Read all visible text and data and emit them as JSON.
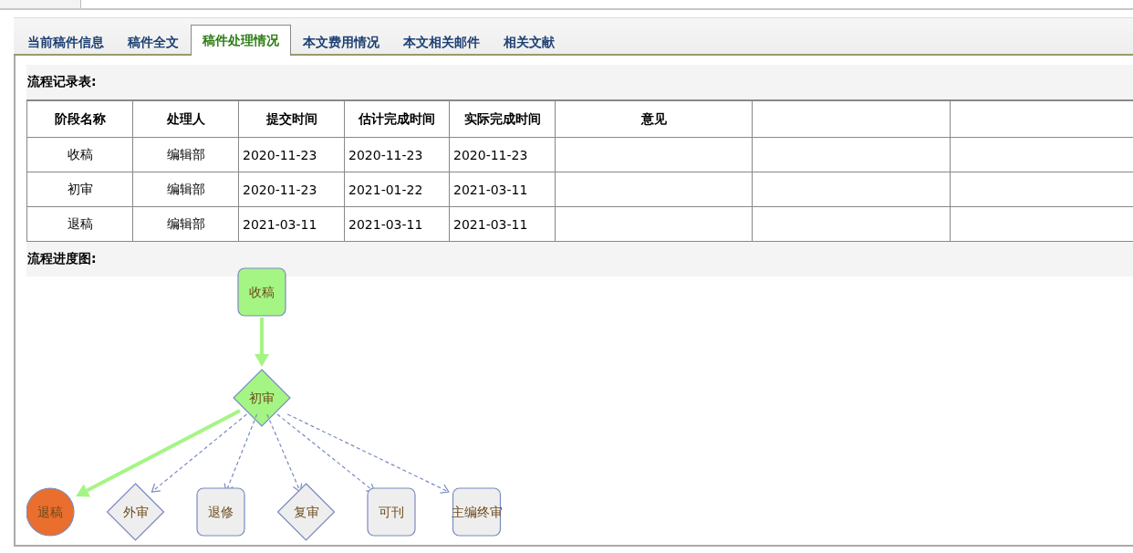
{
  "tabs": [
    {
      "label": "当前稿件信息",
      "selected": false
    },
    {
      "label": "稿件全文",
      "selected": false
    },
    {
      "label": "稿件处理情况",
      "selected": true
    },
    {
      "label": "本文费用情况",
      "selected": false
    },
    {
      "label": "本文相关邮件",
      "selected": false
    },
    {
      "label": "相关文献",
      "selected": false
    }
  ],
  "record_table": {
    "title": "流程记录表:",
    "columns": [
      "阶段名称",
      "处理人",
      "提交时间",
      "估计完成时间",
      "实际完成时间",
      "意见"
    ],
    "rows": [
      [
        "收稿",
        "编辑部",
        "2020-11-23",
        "2020-11-23",
        "2020-11-23"
      ],
      [
        "初审",
        "编辑部",
        "2020-11-23",
        "2021-01-22",
        "2021-03-11"
      ],
      [
        "退稿",
        "编辑部",
        "2021-03-11",
        "2021-03-11",
        "2021-03-11"
      ]
    ]
  },
  "flow_chart": {
    "title": "流程进度图:",
    "start": {
      "label": "收稿",
      "kind": "box",
      "color": "#a5f584",
      "path_taken": true
    },
    "decision": {
      "label": "初审",
      "kind": "diamond",
      "color": "#a5f584"
    },
    "outcomes": [
      {
        "label": "退稿",
        "kind": "circle",
        "color": "#ea6f2e",
        "path_taken": true
      },
      {
        "label": "外审",
        "kind": "diamond",
        "color": "#eeeeee",
        "path_taken": false
      },
      {
        "label": "退修",
        "kind": "box",
        "color": "#eeeeee",
        "path_taken": false
      },
      {
        "label": "复审",
        "kind": "diamond",
        "color": "#eeeeee",
        "path_taken": false
      },
      {
        "label": "可刊",
        "kind": "box",
        "color": "#eeeeee",
        "path_taken": false
      },
      {
        "label": "主编终审",
        "kind": "box",
        "color": "#eeeeee",
        "path_taken": false
      }
    ]
  }
}
